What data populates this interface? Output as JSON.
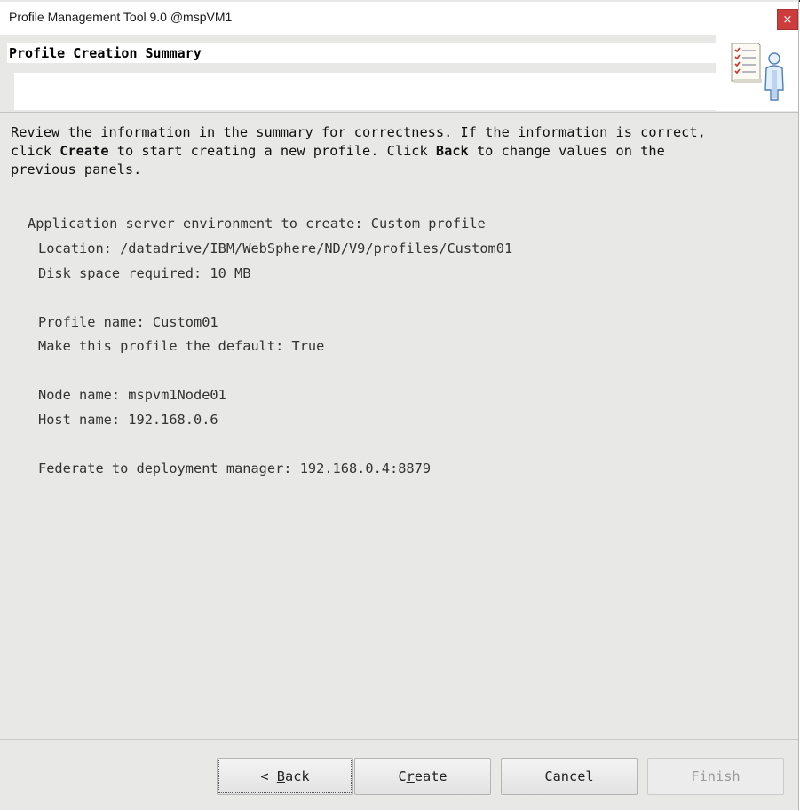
{
  "window": {
    "title": "Profile Management Tool 9.0 @mspVM1",
    "close_glyph": "×"
  },
  "header": {
    "title": "Profile Creation Summary",
    "icon": "checklist-person-icon"
  },
  "intro": {
    "part1": "Review the information in the summary for correctness. If the information is correct,\nclick ",
    "create_word": "Create",
    "part2": " to start creating a new profile. Click ",
    "back_word": "Back",
    "part3": " to change values on the\nprevious panels."
  },
  "summary": {
    "environment": "Application server environment to create: Custom profile",
    "location": "Location: /datadrive/IBM/WebSphere/ND/V9/profiles/Custom01",
    "disk_space": "Disk space required: 10 MB",
    "profile_name": "Profile name: Custom01",
    "default_profile": "Make this profile the default: True",
    "node_name": "Node name: mspvm1Node01",
    "host_name": "Host name: 192.168.0.6",
    "federate": "Federate to deployment manager: 192.168.0.4:8879"
  },
  "buttons": {
    "back": {
      "pre": "< ",
      "mnemonic": "B",
      "post": "ack"
    },
    "create": {
      "pre": "C",
      "mnemonic": "r",
      "post": "eate"
    },
    "cancel": "Cancel",
    "finish": "Finish"
  }
}
